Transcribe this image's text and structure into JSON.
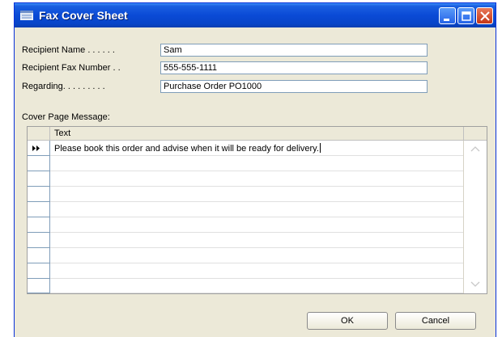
{
  "window": {
    "title": "Fax Cover Sheet"
  },
  "fields": [
    {
      "label": "Recipient Name . . . . . .",
      "value": "Sam"
    },
    {
      "label": "Recipient Fax Number . .",
      "value": "555-555-1111"
    },
    {
      "label": "Regarding. . . . . . . . .",
      "value": "Purchase Order PO1000"
    }
  ],
  "message": {
    "section_label": "Cover Page Message:",
    "column_header": "Text",
    "rows": [
      "Please book this order and advise when it will be ready for delivery.",
      "",
      "",
      "",
      "",
      "",
      "",
      "",
      "",
      ""
    ]
  },
  "buttons": {
    "ok": "OK",
    "cancel": "Cancel"
  },
  "icons": {
    "title": "form-icon",
    "row_pointer": "new-row-pointer-icon",
    "minimize": "minimize-icon",
    "maximize": "maximize-icon",
    "close": "close-icon"
  },
  "colors": {
    "titlebar": "#0a4ad6",
    "window_bg": "#ece9d8",
    "input_border": "#7f9db9"
  }
}
